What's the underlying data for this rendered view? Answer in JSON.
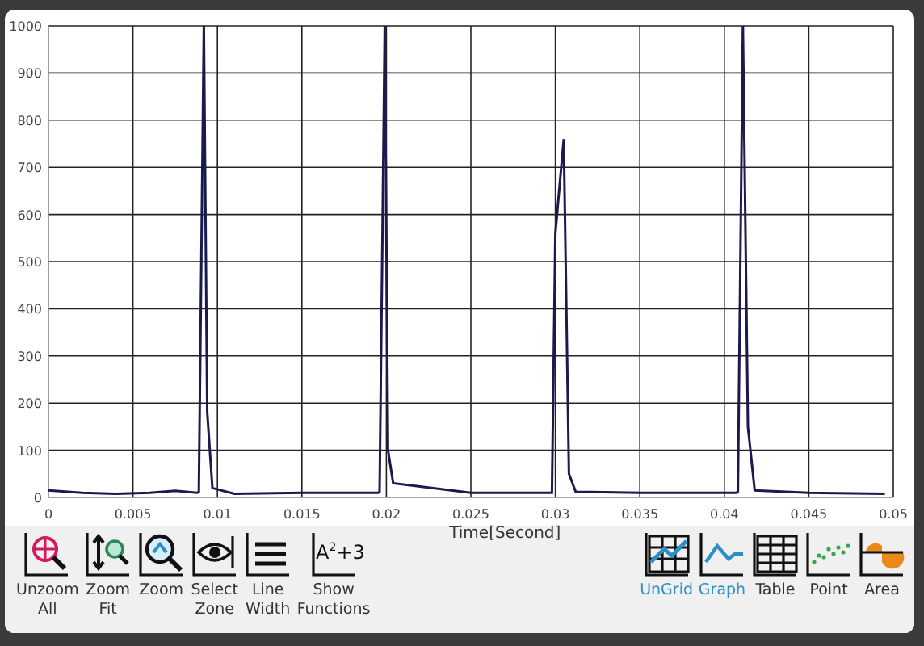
{
  "chart_data": {
    "type": "line",
    "grid": true,
    "xlabel": "Time[Second]",
    "xlim": [
      0,
      0.05
    ],
    "ylim": [
      0,
      1000
    ],
    "xticks": [
      {
        "value": 0,
        "label": "0"
      },
      {
        "value": 0.005,
        "label": "0.005"
      },
      {
        "value": 0.01,
        "label": "0.01"
      },
      {
        "value": 0.015,
        "label": "0.015"
      },
      {
        "value": 0.02,
        "label": "0.02"
      },
      {
        "value": 0.025,
        "label": "0.025"
      },
      {
        "value": 0.03,
        "label": "0.03"
      },
      {
        "value": 0.035,
        "label": "0.035"
      },
      {
        "value": 0.04,
        "label": "0.04"
      },
      {
        "value": 0.045,
        "label": "0.045"
      },
      {
        "value": 0.05,
        "label": "0.05"
      }
    ],
    "yticks": [
      0,
      100,
      200,
      300,
      400,
      500,
      600,
      700,
      800,
      900,
      1000
    ],
    "x": [
      0,
      0.002,
      0.004,
      0.006,
      0.0075,
      0.0088,
      0.0089,
      0.0092,
      0.0094,
      0.0097,
      0.011,
      0.015,
      0.0195,
      0.0196,
      0.0199,
      0.0201,
      0.0204,
      0.025,
      0.0298,
      0.03,
      0.0305,
      0.0308,
      0.0312,
      0.035,
      0.0407,
      0.0408,
      0.0411,
      0.0414,
      0.0418,
      0.045,
      0.0495
    ],
    "series": [
      {
        "color": "#1a1a4e",
        "values": [
          15,
          10,
          8,
          10,
          14,
          10,
          12,
          1000,
          180,
          20,
          8,
          10,
          10,
          12,
          1000,
          100,
          30,
          10,
          10,
          560,
          760,
          50,
          12,
          10,
          10,
          12,
          1000,
          150,
          15,
          10,
          8
        ]
      }
    ]
  },
  "left_tools": [
    {
      "label": "Unzoom All",
      "kind": "unzoom"
    },
    {
      "label": "Zoom Fit",
      "kind": "zoomfit"
    },
    {
      "label": "Zoom",
      "kind": "zoom"
    },
    {
      "label": "Select Zone",
      "kind": "select"
    },
    {
      "label": "Line Width",
      "kind": "linewidth"
    },
    {
      "label": "Show Functions",
      "kind": "functions",
      "glyph": "A",
      "sup": "2",
      "suffix": "+3"
    }
  ],
  "right_tools": [
    {
      "label": "UnGrid",
      "kind": "ungrid",
      "selected": true
    },
    {
      "label": "Graph",
      "kind": "graph",
      "selected": true
    },
    {
      "label": "Table",
      "kind": "table",
      "selected": false
    },
    {
      "label": "Point",
      "kind": "point",
      "selected": false
    },
    {
      "label": "Area",
      "kind": "area",
      "selected": false
    }
  ]
}
